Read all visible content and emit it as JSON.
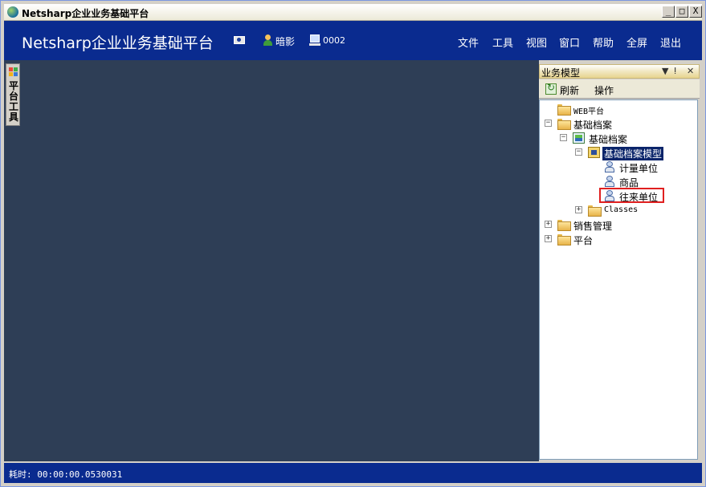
{
  "window": {
    "title": "Netsharp企业业务基础平台",
    "controls": {
      "minimize": "_",
      "maximize": "□",
      "close": "X"
    }
  },
  "header": {
    "app_title": "Netsharp企业业务基础平台",
    "user_name": "暗影",
    "workstation": "0002",
    "menu": [
      "文件",
      "工具",
      "视图",
      "窗口",
      "帮助",
      "全屏",
      "退出"
    ]
  },
  "toolbox": {
    "label": "平台工具"
  },
  "panel": {
    "title": "业务模型",
    "controls": {
      "dropdown": "▼",
      "pin": "ⵑ",
      "close": "✕"
    },
    "toolbar": {
      "refresh": "刷新",
      "actions": "操作"
    },
    "tree": [
      {
        "label": "WEB平台",
        "type": "folder",
        "expander": ""
      },
      {
        "label": "基础档案",
        "type": "folder",
        "expander": "⊟"
      },
      {
        "label": "基础档案",
        "type": "db",
        "expander": "⊟"
      },
      {
        "label": "基础档案模型",
        "type": "model",
        "expander": "⊟",
        "selected": true
      },
      {
        "label": "计量单位",
        "type": "entity",
        "expander": ""
      },
      {
        "label": "商品",
        "type": "entity",
        "expander": ""
      },
      {
        "label": "往来单位",
        "type": "entity",
        "expander": "",
        "highlighted": true
      },
      {
        "label": "Classes",
        "type": "folder",
        "expander": "⊞"
      },
      {
        "label": "销售管理",
        "type": "folder",
        "expander": "⊞"
      },
      {
        "label": "平台",
        "type": "folder",
        "expander": "⊞"
      }
    ]
  },
  "status": {
    "text": "耗时: 00:00:00.0530031"
  },
  "colors": {
    "header_bg": "#0a2b8f",
    "workspace_bg": "#2e3e56",
    "selection_bg": "#0a246a",
    "highlight_border": "#e02020"
  }
}
